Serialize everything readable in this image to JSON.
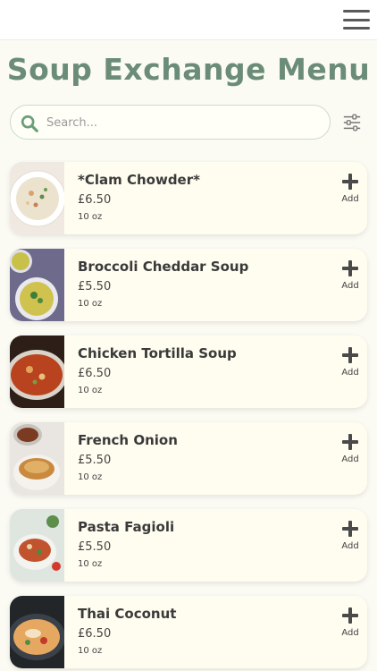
{
  "header": {
    "menu_icon": "hamburger-menu-icon"
  },
  "title": "Soup Exchange Menu",
  "search": {
    "placeholder": "Search...",
    "icon": "search-icon"
  },
  "filter": {
    "icon": "sliders-filter-icon"
  },
  "colors": {
    "accent": "#6b8c77",
    "search_border": "#c8dcc8",
    "card_bg": "#fffdf0",
    "page_bg": "#fbfbf4"
  },
  "items": [
    {
      "name": "*Clam Chowder*",
      "price": "£6.50",
      "size": "10 oz",
      "add_label": "Add"
    },
    {
      "name": "Broccoli Cheddar Soup",
      "price": "£5.50",
      "size": "10 oz",
      "add_label": "Add"
    },
    {
      "name": "Chicken Tortilla Soup",
      "price": "£6.50",
      "size": "10 oz",
      "add_label": "Add"
    },
    {
      "name": "French Onion",
      "price": "£5.50",
      "size": "10 oz",
      "add_label": "Add"
    },
    {
      "name": "Pasta Fagioli",
      "price": "£5.50",
      "size": "10 oz",
      "add_label": "Add"
    },
    {
      "name": "Thai Coconut",
      "price": "£6.50",
      "size": "10 oz",
      "add_label": "Add"
    }
  ]
}
